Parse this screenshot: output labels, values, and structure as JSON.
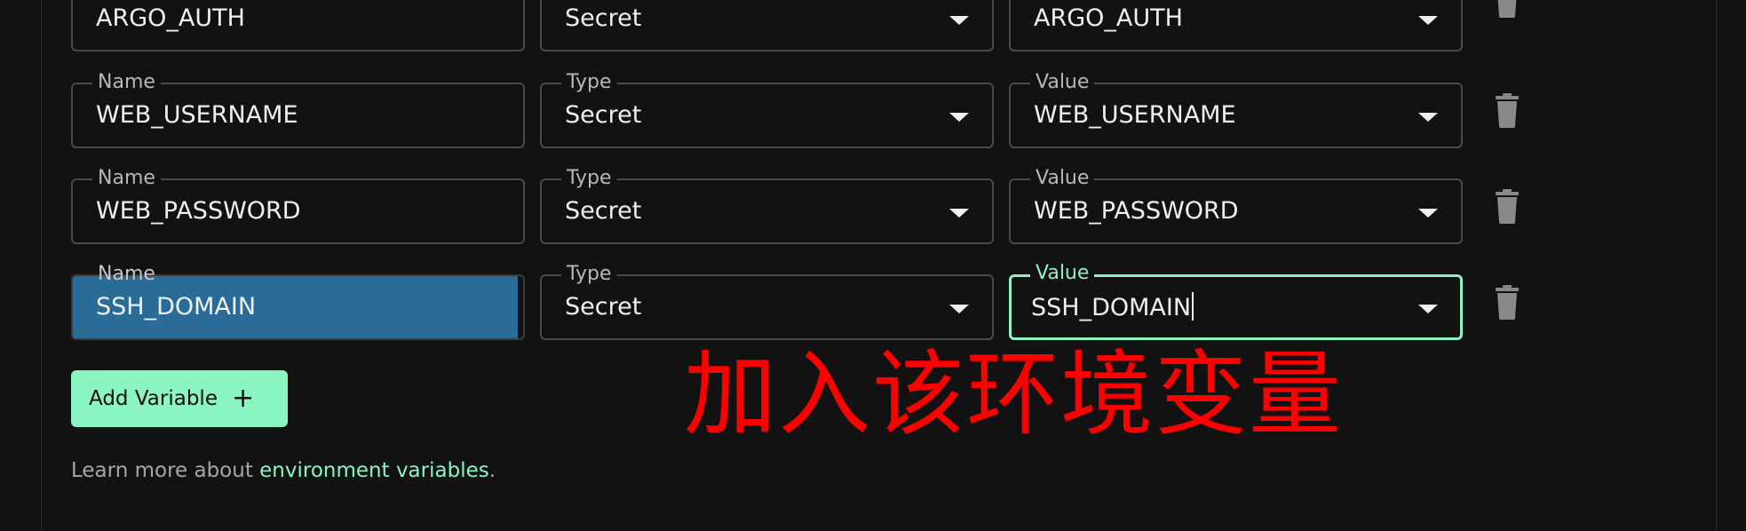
{
  "labels": {
    "name": "Name",
    "type": "Type",
    "value": "Value"
  },
  "rows": [
    {
      "name": "ARGO_AUTH",
      "type": "Secret",
      "value": "ARGO_AUTH"
    },
    {
      "name": "WEB_USERNAME",
      "type": "Secret",
      "value": "WEB_USERNAME"
    },
    {
      "name": "WEB_PASSWORD",
      "type": "Secret",
      "value": "WEB_PASSWORD"
    },
    {
      "name": "SSH_DOMAIN",
      "type": "Secret",
      "value": "SSH_DOMAIN"
    }
  ],
  "add_button": {
    "label": "Add Variable",
    "icon": "plus-icon"
  },
  "annotation": "加入该环境变量",
  "learn_more": {
    "prefix": "Learn more about ",
    "link": "environment variables",
    "suffix": "."
  },
  "icons": {
    "delete": "trash-icon",
    "dropdown": "chevron-down-icon"
  },
  "colors": {
    "accent": "#8bf5c2",
    "selection": "#2a6b98",
    "annotation": "#ff0000",
    "background": "#121212"
  }
}
